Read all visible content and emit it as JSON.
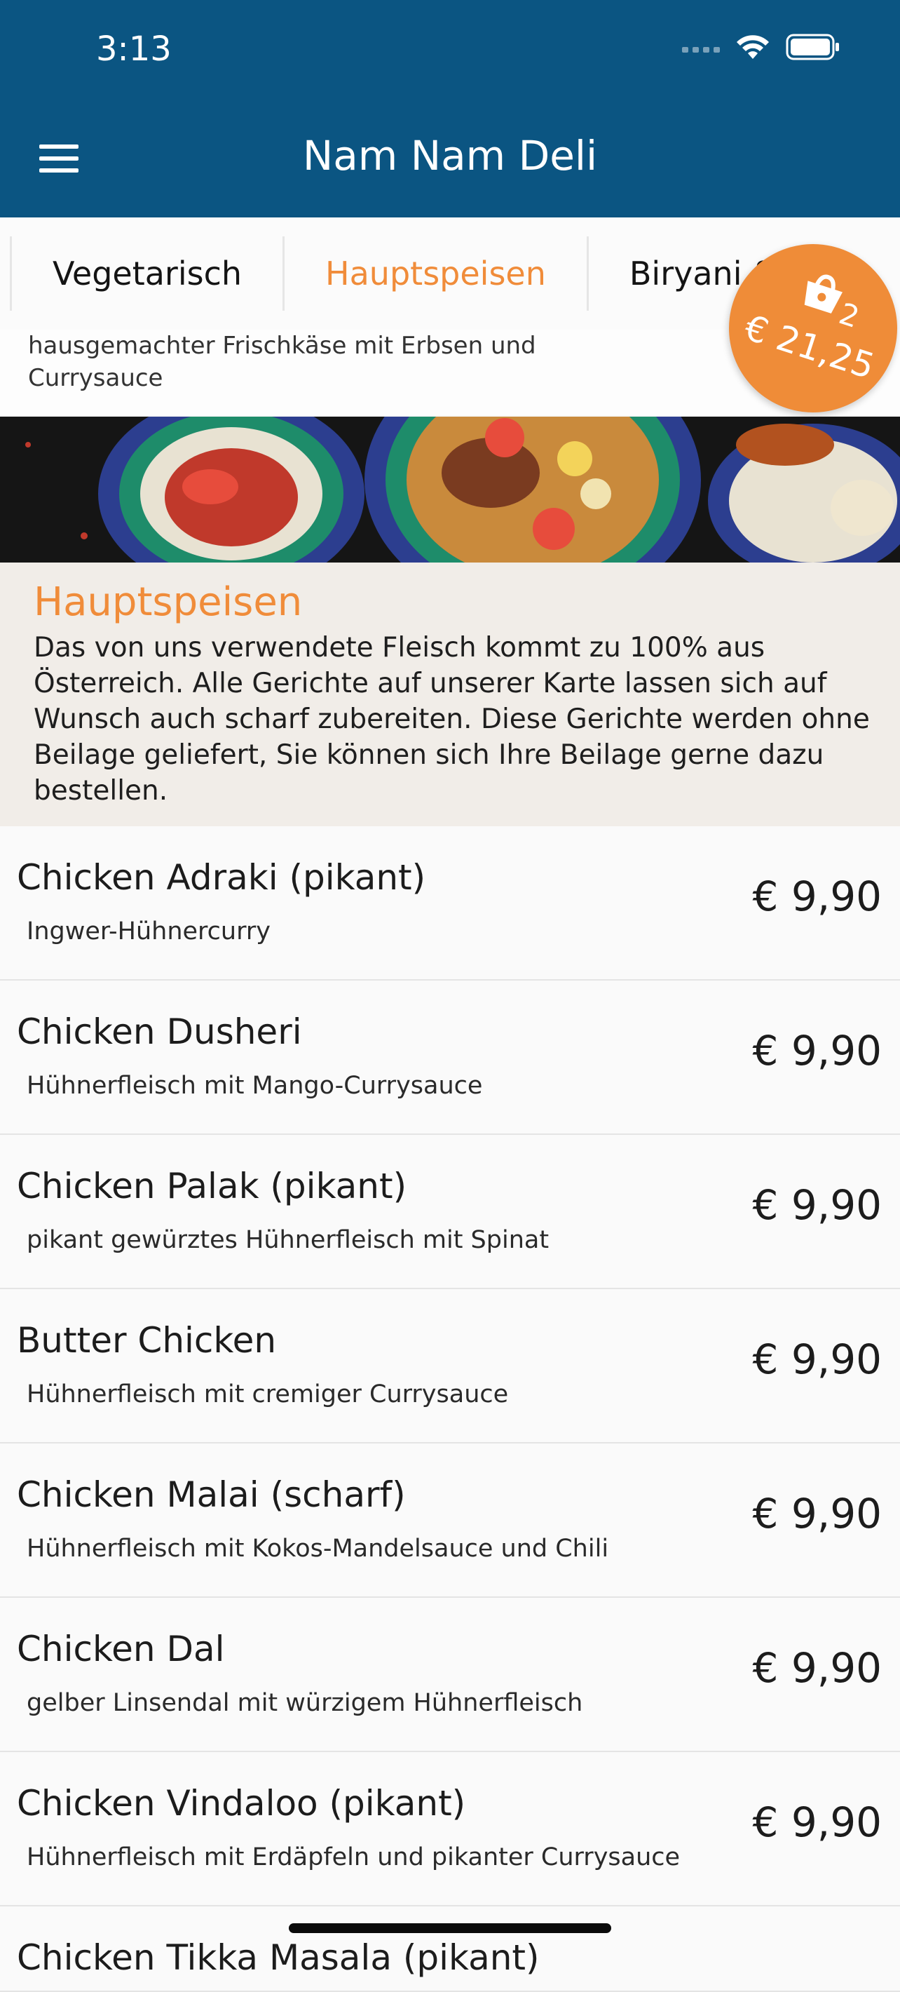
{
  "status": {
    "time": "3:13"
  },
  "header": {
    "title": "Nam Nam Deli"
  },
  "tabs": [
    {
      "label": "Vegetarisch"
    },
    {
      "label": "Hauptspeisen"
    },
    {
      "label": "Biryani & Cc"
    }
  ],
  "cart": {
    "count": "2",
    "total": "€ 21,25"
  },
  "previous_item": {
    "description": "hausgemachter Frischkäse mit Erbsen und Currysauce"
  },
  "section": {
    "title": "Hauptspeisen",
    "description": "Das von uns verwendete Fleisch kommt zu 100% aus Österreich. Alle Gerichte auf unserer Karte lassen sich auf Wunsch auch scharf zubereiten. Diese Gerichte werden ohne Beilage geliefert, Sie können sich Ihre Beilage gerne dazu bestellen."
  },
  "items": [
    {
      "name": "Chicken Adraki (pikant)",
      "description": "Ingwer-Hühnercurry",
      "price": "€ 9,90"
    },
    {
      "name": "Chicken Dusheri",
      "description": "Hühnerfleisch mit Mango-Currysauce",
      "price": "€ 9,90"
    },
    {
      "name": "Chicken Palak (pikant)",
      "description": "pikant gewürztes Hühnerfleisch mit Spinat",
      "price": "€ 9,90"
    },
    {
      "name": "Butter Chicken",
      "description": "Hühnerfleisch mit cremiger Currysauce",
      "price": "€ 9,90"
    },
    {
      "name": "Chicken Malai (scharf)",
      "description": "Hühnerfleisch mit Kokos-Mandelsauce und Chili",
      "price": "€ 9,90"
    },
    {
      "name": "Chicken Dal",
      "description": "gelber Linsendal mit würzigem Hühnerfleisch",
      "price": "€ 9,90"
    },
    {
      "name": "Chicken Vindaloo (pikant)",
      "description": "Hühnerfleisch mit Erdäpfeln und pikanter Currysauce",
      "price": "€ 9,90"
    },
    {
      "name": "Chicken Tikka Masala (pikant)"
    }
  ],
  "colors": {
    "header": "#0b5582",
    "accent": "#f08c3a",
    "section_bg": "#f1ede8"
  }
}
